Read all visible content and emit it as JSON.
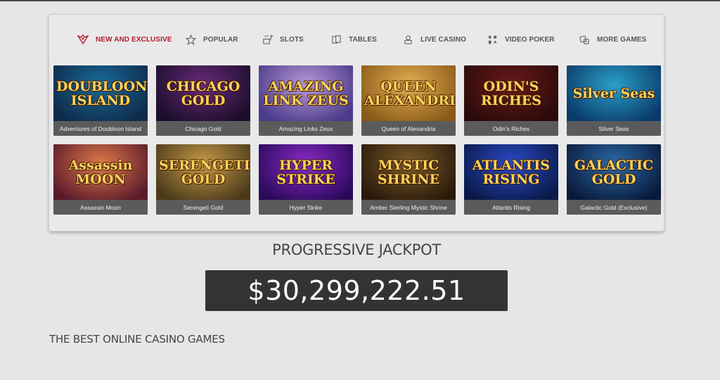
{
  "tabs": [
    {
      "label": "NEW AND EXCLUSIVE",
      "icon": "crest-icon",
      "active": true
    },
    {
      "label": "POPULAR",
      "icon": "star-icon",
      "active": false
    },
    {
      "label": "SLOTS",
      "icon": "slot-icon",
      "active": false
    },
    {
      "label": "TABLES",
      "icon": "cards-icon",
      "active": false
    },
    {
      "label": "LIVE CASINO",
      "icon": "live-dealer-icon",
      "active": false
    },
    {
      "label": "VIDEO POKER",
      "icon": "suits-icon",
      "active": false
    },
    {
      "label": "MORE GAMES",
      "icon": "dice-icon",
      "active": false
    }
  ],
  "games": [
    {
      "title": "Adventures of Doubloon Island",
      "logo": "DOUBLOON ISLAND",
      "colors": [
        "#1a6b9a",
        "#0e2b4a"
      ]
    },
    {
      "title": "Chicago Gold",
      "logo": "CHICAGO GOLD",
      "colors": [
        "#6a2a7a",
        "#1b0e2a"
      ]
    },
    {
      "title": "Amazing Links Zeus",
      "logo": "AMAZING LINK ZEUS",
      "colors": [
        "#b99ad6",
        "#4a3a8a"
      ]
    },
    {
      "title": "Queen of Alexandria",
      "logo": "QUEEN ALEXANDRIA",
      "colors": [
        "#e3b050",
        "#8a5a1a"
      ]
    },
    {
      "title": "Odin's Riches",
      "logo": "ODIN'S RICHES",
      "colors": [
        "#6a1a1a",
        "#2a0a0a"
      ]
    },
    {
      "title": "Silver Seas",
      "logo": "Silver Seas",
      "colors": [
        "#2aa0c8",
        "#0a3a6a"
      ]
    },
    {
      "title": "Assassin Moon",
      "logo": "Assassin MOON",
      "colors": [
        "#e07a4a",
        "#5a1a2a"
      ]
    },
    {
      "title": "Serengeti Gold",
      "logo": "SERENGETI GOLD",
      "colors": [
        "#c89a4a",
        "#4a3a1a"
      ]
    },
    {
      "title": "Hyper Strike",
      "logo": "HYPER STRIKE",
      "colors": [
        "#8a2ac8",
        "#2a0a5a"
      ]
    },
    {
      "title": "Amber Sterling Mystic Shrine",
      "logo": "MYSTIC SHRINE",
      "colors": [
        "#7a5a2a",
        "#2a1a0a"
      ]
    },
    {
      "title": "Atlantis Rising",
      "logo": "ATLANTIS RISING",
      "colors": [
        "#2a4ac8",
        "#0a1a4a"
      ]
    },
    {
      "title": "Galactic Gold (Exclusive)",
      "logo": "GALACTIC GOLD",
      "colors": [
        "#2a6aa8",
        "#0a1a3a"
      ]
    }
  ],
  "jackpot": {
    "title": "PROGRESSIVE JACKPOT",
    "amount": "$30,299,222.51"
  },
  "section": {
    "title": "THE BEST ONLINE CASINO GAMES"
  },
  "accent": "#b31b2e"
}
